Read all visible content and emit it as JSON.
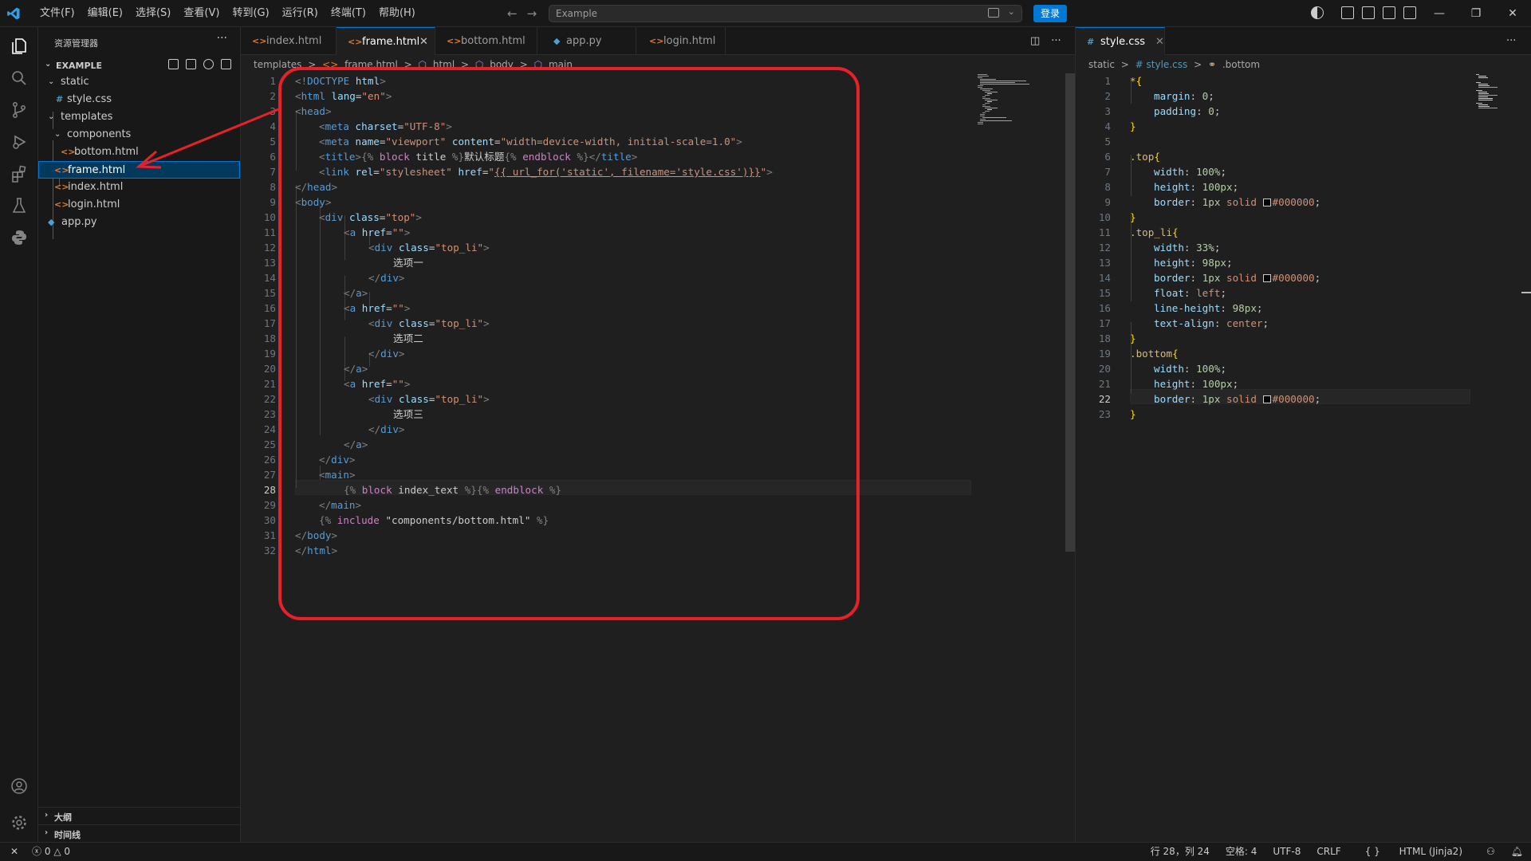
{
  "titlebar": {
    "menu": [
      "文件(F)",
      "编辑(E)",
      "选择(S)",
      "查看(V)",
      "转到(G)",
      "运行(R)",
      "终端(T)",
      "帮助(H)"
    ],
    "search_text": "Example",
    "login_label": "登录",
    "window_controls": [
      "minimize-icon",
      "restore-icon",
      "close-icon"
    ]
  },
  "sidebar": {
    "title": "资源管理器",
    "more": "···",
    "section": "EXAMPLE",
    "tree": [
      {
        "name": "static",
        "type": "folder",
        "depth": 0
      },
      {
        "name": "style.css",
        "type": "css",
        "depth": 1
      },
      {
        "name": "templates",
        "type": "folder",
        "depth": 0
      },
      {
        "name": "components",
        "type": "folder",
        "depth": 1
      },
      {
        "name": "bottom.html",
        "type": "html",
        "depth": 2
      },
      {
        "name": "frame.html",
        "type": "html",
        "depth": 1,
        "selected": true
      },
      {
        "name": "index.html",
        "type": "html",
        "depth": 1
      },
      {
        "name": "login.html",
        "type": "html",
        "depth": 1
      },
      {
        "name": "app.py",
        "type": "py",
        "depth": 0
      }
    ],
    "outline": "大纲",
    "timeline": "时间线"
  },
  "editor1": {
    "tabs": [
      {
        "label": "index.html",
        "icon": "<>"
      },
      {
        "label": "frame.html",
        "icon": "<>",
        "active": true,
        "close": "✕"
      },
      {
        "label": "bottom.html",
        "icon": "<>"
      },
      {
        "label": "app.py",
        "icon": "py"
      },
      {
        "label": "login.html",
        "icon": "<>"
      }
    ],
    "breadcrumbs": [
      "templates",
      ">",
      "frame.html",
      ">",
      "html",
      ">",
      "body",
      ">",
      "main"
    ],
    "current_line": 28,
    "line_count": 32
  },
  "editor2": {
    "tab": "style.css",
    "tab_close": "✕",
    "breadcrumbs": [
      "static",
      ">",
      "# style.css",
      ">",
      ".bottom"
    ],
    "current_line": 22,
    "line_count": 23
  },
  "statusbar": {
    "errors": "0",
    "warnings": "0",
    "position": "行 28，列 24",
    "indent": "空格: 4",
    "encoding": "UTF-8",
    "eol": "CRLF",
    "language": "HTML (Jinja2)"
  },
  "colors": {
    "accent": "#0078d4",
    "annotation": "#e8202a",
    "editor_bg": "#1f1f1f"
  }
}
